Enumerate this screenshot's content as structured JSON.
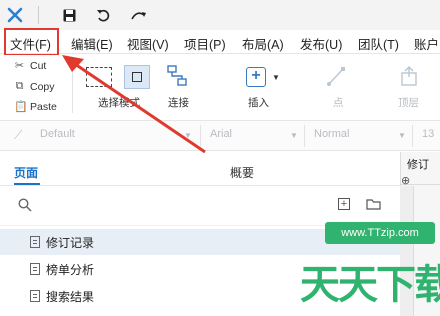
{
  "titlebar": {
    "logo_icon": "axure-x-logo",
    "buttons": [
      "save-icon",
      "undo-icon",
      "redo-icon"
    ]
  },
  "menu": {
    "items": [
      "文件(F)",
      "编辑(E)",
      "视图(V)",
      "项目(P)",
      "布局(A)",
      "发布(U)",
      "团队(T)",
      "账户"
    ]
  },
  "clipboard": {
    "cut": "Cut",
    "copy": "Copy",
    "paste": "Paste"
  },
  "tools": {
    "select_mode": "选择模式",
    "connect": "连接",
    "insert": "插入",
    "point": "点",
    "top": "顶层"
  },
  "format": {
    "style": "Default",
    "font": "Arial",
    "weight": "Normal",
    "size": "13"
  },
  "pages_panel": {
    "tabs": [
      "页面",
      "概要"
    ],
    "active_tab": "页面",
    "pages": [
      {
        "label": "修订记录",
        "selected": true
      },
      {
        "label": "榜单分析",
        "selected": false
      },
      {
        "label": "搜索结果",
        "selected": false
      }
    ]
  },
  "right_panel": {
    "title": "修订"
  },
  "watermark": {
    "url": "www.TTzip.com",
    "text": "天天下载"
  },
  "colors": {
    "accent": "#1a73c8",
    "highlight_red": "#e03a2f",
    "watermark_green": "#2fb36e"
  }
}
